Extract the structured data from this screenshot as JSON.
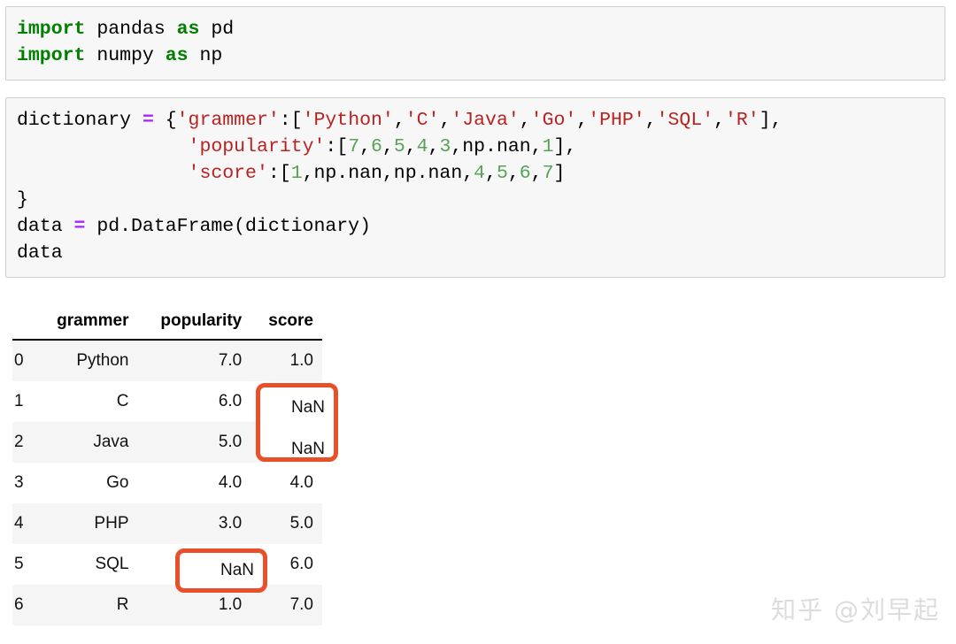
{
  "notebook": {
    "cells": [
      {
        "id": "cell-1",
        "lines": [
          [
            {
              "t": "import",
              "c": "kw"
            },
            {
              "t": " pandas ",
              "c": "pln"
            },
            {
              "t": "as",
              "c": "kw"
            },
            {
              "t": " pd",
              "c": "pln"
            }
          ],
          [
            {
              "t": "import",
              "c": "kw"
            },
            {
              "t": " numpy ",
              "c": "pln"
            },
            {
              "t": "as",
              "c": "kw"
            },
            {
              "t": " np",
              "c": "pln"
            }
          ]
        ]
      },
      {
        "id": "cell-2",
        "lines": [
          [
            {
              "t": "dictionary ",
              "c": "pln"
            },
            {
              "t": "=",
              "c": "op"
            },
            {
              "t": " {",
              "c": "pln"
            },
            {
              "t": "'grammer'",
              "c": "str"
            },
            {
              "t": ":[",
              "c": "pln"
            },
            {
              "t": "'Python'",
              "c": "str"
            },
            {
              "t": ",",
              "c": "pln"
            },
            {
              "t": "'C'",
              "c": "str"
            },
            {
              "t": ",",
              "c": "pln"
            },
            {
              "t": "'Java'",
              "c": "str"
            },
            {
              "t": ",",
              "c": "pln"
            },
            {
              "t": "'Go'",
              "c": "str"
            },
            {
              "t": ",",
              "c": "pln"
            },
            {
              "t": "'PHP'",
              "c": "str"
            },
            {
              "t": ",",
              "c": "pln"
            },
            {
              "t": "'SQL'",
              "c": "str"
            },
            {
              "t": ",",
              "c": "pln"
            },
            {
              "t": "'R'",
              "c": "str"
            },
            {
              "t": "],",
              "c": "pln"
            }
          ],
          [
            {
              "t": "               ",
              "c": "pln"
            },
            {
              "t": "'popularity'",
              "c": "str"
            },
            {
              "t": ":[",
              "c": "pln"
            },
            {
              "t": "7",
              "c": "num"
            },
            {
              "t": ",",
              "c": "pln"
            },
            {
              "t": "6",
              "c": "num"
            },
            {
              "t": ",",
              "c": "pln"
            },
            {
              "t": "5",
              "c": "num"
            },
            {
              "t": ",",
              "c": "pln"
            },
            {
              "t": "4",
              "c": "num"
            },
            {
              "t": ",",
              "c": "pln"
            },
            {
              "t": "3",
              "c": "num"
            },
            {
              "t": ",np.nan,",
              "c": "pln"
            },
            {
              "t": "1",
              "c": "num"
            },
            {
              "t": "],",
              "c": "pln"
            }
          ],
          [
            {
              "t": "               ",
              "c": "pln"
            },
            {
              "t": "'score'",
              "c": "str"
            },
            {
              "t": ":[",
              "c": "pln"
            },
            {
              "t": "1",
              "c": "num"
            },
            {
              "t": ",np.nan,np.nan,",
              "c": "pln"
            },
            {
              "t": "4",
              "c": "num"
            },
            {
              "t": ",",
              "c": "pln"
            },
            {
              "t": "5",
              "c": "num"
            },
            {
              "t": ",",
              "c": "pln"
            },
            {
              "t": "6",
              "c": "num"
            },
            {
              "t": ",",
              "c": "pln"
            },
            {
              "t": "7",
              "c": "num"
            },
            {
              "t": "]",
              "c": "pln"
            }
          ],
          [
            {
              "t": "}",
              "c": "pln"
            }
          ],
          [
            {
              "t": "data ",
              "c": "pln"
            },
            {
              "t": "=",
              "c": "op"
            },
            {
              "t": " pd.DataFrame(dictionary)",
              "c": "pln"
            }
          ],
          [
            {
              "t": "data",
              "c": "pln"
            }
          ]
        ]
      }
    ]
  },
  "dataframe": {
    "index_header": "",
    "columns": [
      "grammer",
      "popularity",
      "score"
    ],
    "index": [
      "0",
      "1",
      "2",
      "3",
      "4",
      "5",
      "6"
    ],
    "rows": [
      [
        "Python",
        "7.0",
        "1.0"
      ],
      [
        "C",
        "6.0",
        "NaN"
      ],
      [
        "Java",
        "5.0",
        "NaN"
      ],
      [
        "Go",
        "4.0",
        "4.0"
      ],
      [
        "PHP",
        "3.0",
        "5.0"
      ],
      [
        "SQL",
        "NaN",
        "6.0"
      ],
      [
        "R",
        "1.0",
        "7.0"
      ]
    ]
  },
  "annotations": {
    "accent_color": "#e8502b",
    "boxes": [
      {
        "name": "score-nan-box",
        "labels": [
          "NaN",
          "NaN"
        ]
      },
      {
        "name": "popularity-nan-box",
        "labels": [
          "NaN"
        ]
      }
    ],
    "label_nan_1": "NaN",
    "label_nan_2": "NaN",
    "label_nan_3": "NaN"
  },
  "watermark": {
    "text": "知乎 @刘早起"
  }
}
